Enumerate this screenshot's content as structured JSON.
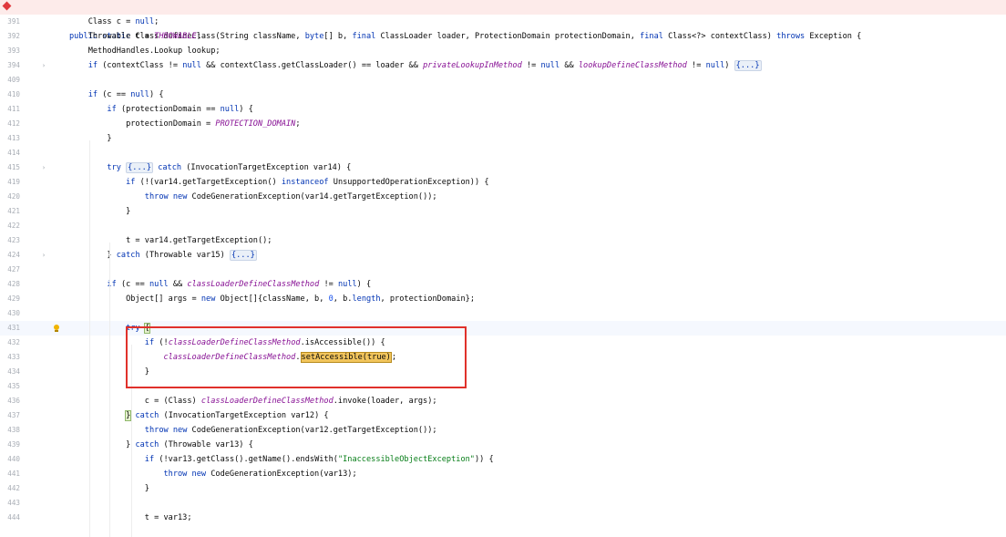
{
  "editor": {
    "lines": [
      {
        "n": "391",
        "parts": [
          [
            "",
            "    Class c = "
          ],
          [
            "kw",
            "null"
          ],
          [
            "",
            ";"
          ]
        ]
      },
      {
        "n": "392",
        "parts": [
          [
            "",
            "    Throwable t = "
          ],
          [
            "fld",
            "THROWABLE"
          ],
          [
            "",
            ";"
          ]
        ]
      },
      {
        "n": "393",
        "parts": [
          [
            "",
            "    MethodHandles.Lookup lookup;"
          ]
        ]
      },
      {
        "n": "394",
        "fold": "›",
        "parts": [
          [
            "",
            "    "
          ],
          [
            "kw",
            "if"
          ],
          [
            "",
            " (contextClass != "
          ],
          [
            "kw",
            "null"
          ],
          [
            "",
            " && contextClass.getClassLoader() == loader && "
          ],
          [
            "fld",
            "privateLookupInMethod"
          ],
          [
            "",
            " != "
          ],
          [
            "kw",
            "null"
          ],
          [
            "",
            " && "
          ],
          [
            "fld",
            "lookupDefineClassMethod"
          ],
          [
            "",
            " != "
          ],
          [
            "kw",
            "null"
          ],
          [
            "",
            ") "
          ],
          [
            "chip",
            "{...}"
          ]
        ]
      },
      {
        "n": "409",
        "parts": []
      },
      {
        "n": "410",
        "parts": [
          [
            "",
            "    "
          ],
          [
            "kw",
            "if"
          ],
          [
            "",
            " (c == "
          ],
          [
            "kw",
            "null"
          ],
          [
            "",
            ") {"
          ]
        ]
      },
      {
        "n": "411",
        "parts": [
          [
            "",
            "        "
          ],
          [
            "kw",
            "if"
          ],
          [
            "",
            " (protectionDomain == "
          ],
          [
            "kw",
            "null"
          ],
          [
            "",
            ") {"
          ]
        ]
      },
      {
        "n": "412",
        "parts": [
          [
            "",
            "            protectionDomain = "
          ],
          [
            "fld",
            "PROTECTION_DOMAIN"
          ],
          [
            "",
            ";"
          ]
        ]
      },
      {
        "n": "413",
        "parts": [
          [
            "",
            "        }"
          ]
        ]
      },
      {
        "n": "414",
        "parts": []
      },
      {
        "n": "415",
        "fold": "›",
        "parts": [
          [
            "",
            "        "
          ],
          [
            "kw",
            "try"
          ],
          [
            "",
            " "
          ],
          [
            "chip",
            "{...}"
          ],
          [
            "",
            " "
          ],
          [
            "kw",
            "catch"
          ],
          [
            "",
            " (InvocationTargetException var14) {"
          ]
        ]
      },
      {
        "n": "419",
        "parts": [
          [
            "",
            "            "
          ],
          [
            "kw",
            "if"
          ],
          [
            "",
            " (!(var14.getTargetException() "
          ],
          [
            "kw",
            "instanceof"
          ],
          [
            "",
            " UnsupportedOperationException)) {"
          ]
        ]
      },
      {
        "n": "420",
        "parts": [
          [
            "",
            "                "
          ],
          [
            "kw",
            "throw new"
          ],
          [
            "",
            " CodeGenerationException(var14.getTargetException());"
          ]
        ]
      },
      {
        "n": "421",
        "parts": [
          [
            "",
            "            }"
          ]
        ]
      },
      {
        "n": "422",
        "parts": []
      },
      {
        "n": "423",
        "parts": [
          [
            "",
            "            t = var14.getTargetException();"
          ]
        ]
      },
      {
        "n": "424",
        "fold": "›",
        "parts": [
          [
            "",
            "        } "
          ],
          [
            "kw",
            "catch"
          ],
          [
            "",
            " (Throwable var15) "
          ],
          [
            "chip",
            "{...}"
          ]
        ]
      },
      {
        "n": "427",
        "parts": []
      },
      {
        "n": "428",
        "parts": [
          [
            "",
            "        "
          ],
          [
            "kw",
            "if"
          ],
          [
            "",
            " (c == "
          ],
          [
            "kw",
            "null"
          ],
          [
            "",
            " && "
          ],
          [
            "fld",
            "classLoaderDefineClassMethod"
          ],
          [
            "",
            " != "
          ],
          [
            "kw",
            "null"
          ],
          [
            "",
            ") {"
          ]
        ]
      },
      {
        "n": "429",
        "parts": [
          [
            "",
            "            Object[] args = "
          ],
          [
            "kw",
            "new"
          ],
          [
            "",
            " Object[]{className, b, "
          ],
          [
            "num",
            "0"
          ],
          [
            "",
            ", b."
          ],
          [
            "kw",
            "length"
          ],
          [
            "",
            ", protectionDomain};"
          ]
        ]
      },
      {
        "n": "430",
        "parts": []
      },
      {
        "n": "431",
        "current": true,
        "bulb": true,
        "parts": [
          [
            "",
            "            "
          ],
          [
            "kw",
            "try"
          ],
          [
            "",
            " "
          ],
          [
            "brace",
            "{"
          ]
        ]
      },
      {
        "n": "432",
        "parts": [
          [
            "",
            "                "
          ],
          [
            "kw",
            "if"
          ],
          [
            "",
            " (!"
          ],
          [
            "fld",
            "classLoaderDefineClassMethod"
          ],
          [
            "",
            ".isAccessible()) {"
          ]
        ]
      },
      {
        "n": "433",
        "parts": [
          [
            "",
            "                    "
          ],
          [
            "fld",
            "classLoaderDefineClassMethod"
          ],
          [
            "",
            "."
          ],
          [
            "usage",
            "setAccessible(true)"
          ],
          [
            "",
            ";"
          ]
        ]
      },
      {
        "n": "434",
        "parts": [
          [
            "",
            "                }"
          ]
        ]
      },
      {
        "n": "435",
        "parts": []
      },
      {
        "n": "436",
        "parts": [
          [
            "",
            "                c = (Class) "
          ],
          [
            "fld",
            "classLoaderDefineClassMethod"
          ],
          [
            "",
            ".invoke(loader, args);"
          ]
        ]
      },
      {
        "n": "437",
        "parts": [
          [
            "",
            "            "
          ],
          [
            "brace",
            "}"
          ],
          [
            "",
            " "
          ],
          [
            "kw",
            "catch"
          ],
          [
            "",
            " (InvocationTargetException var12) {"
          ]
        ]
      },
      {
        "n": "438",
        "parts": [
          [
            "",
            "                "
          ],
          [
            "kw",
            "throw new"
          ],
          [
            "",
            " CodeGenerationException(var12.getTargetException());"
          ]
        ]
      },
      {
        "n": "439",
        "parts": [
          [
            "",
            "            } "
          ],
          [
            "kw",
            "catch"
          ],
          [
            "",
            " (Throwable var13) {"
          ]
        ]
      },
      {
        "n": "440",
        "parts": [
          [
            "",
            "                "
          ],
          [
            "kw",
            "if"
          ],
          [
            "",
            " (!var13.getClass().getName().endsWith("
          ],
          [
            "str",
            "\"InaccessibleObjectException\""
          ],
          [
            "",
            ")) {"
          ]
        ]
      },
      {
        "n": "441",
        "parts": [
          [
            "",
            "                    "
          ],
          [
            "kw",
            "throw new"
          ],
          [
            "",
            " CodeGenerationException(var13);"
          ]
        ]
      },
      {
        "n": "442",
        "parts": [
          [
            "",
            "                }"
          ]
        ]
      },
      {
        "n": "443",
        "parts": []
      },
      {
        "n": "444",
        "parts": [
          [
            "",
            "                t = var13;"
          ]
        ]
      }
    ],
    "header": {
      "parts": [
        [
          "kw",
          "public static"
        ],
        [
          "",
          " Class defineClass(String className, "
        ],
        [
          "kw",
          "byte"
        ],
        [
          "",
          "[] b, "
        ],
        [
          "kw",
          "final"
        ],
        [
          "",
          " ClassLoader loader, ProtectionDomain protectionDomain, "
        ],
        [
          "kw",
          "final"
        ],
        [
          "",
          " Class<?> contextClass) "
        ],
        [
          "kw",
          "throws"
        ],
        [
          "",
          " Exception {"
        ]
      ]
    },
    "colors": {
      "keyword": "#0033b3",
      "field": "#871094",
      "string": "#067d17",
      "number": "#1750eb",
      "annotation_box": "#e0312b",
      "usage_highlight": "#f2c55c"
    }
  }
}
